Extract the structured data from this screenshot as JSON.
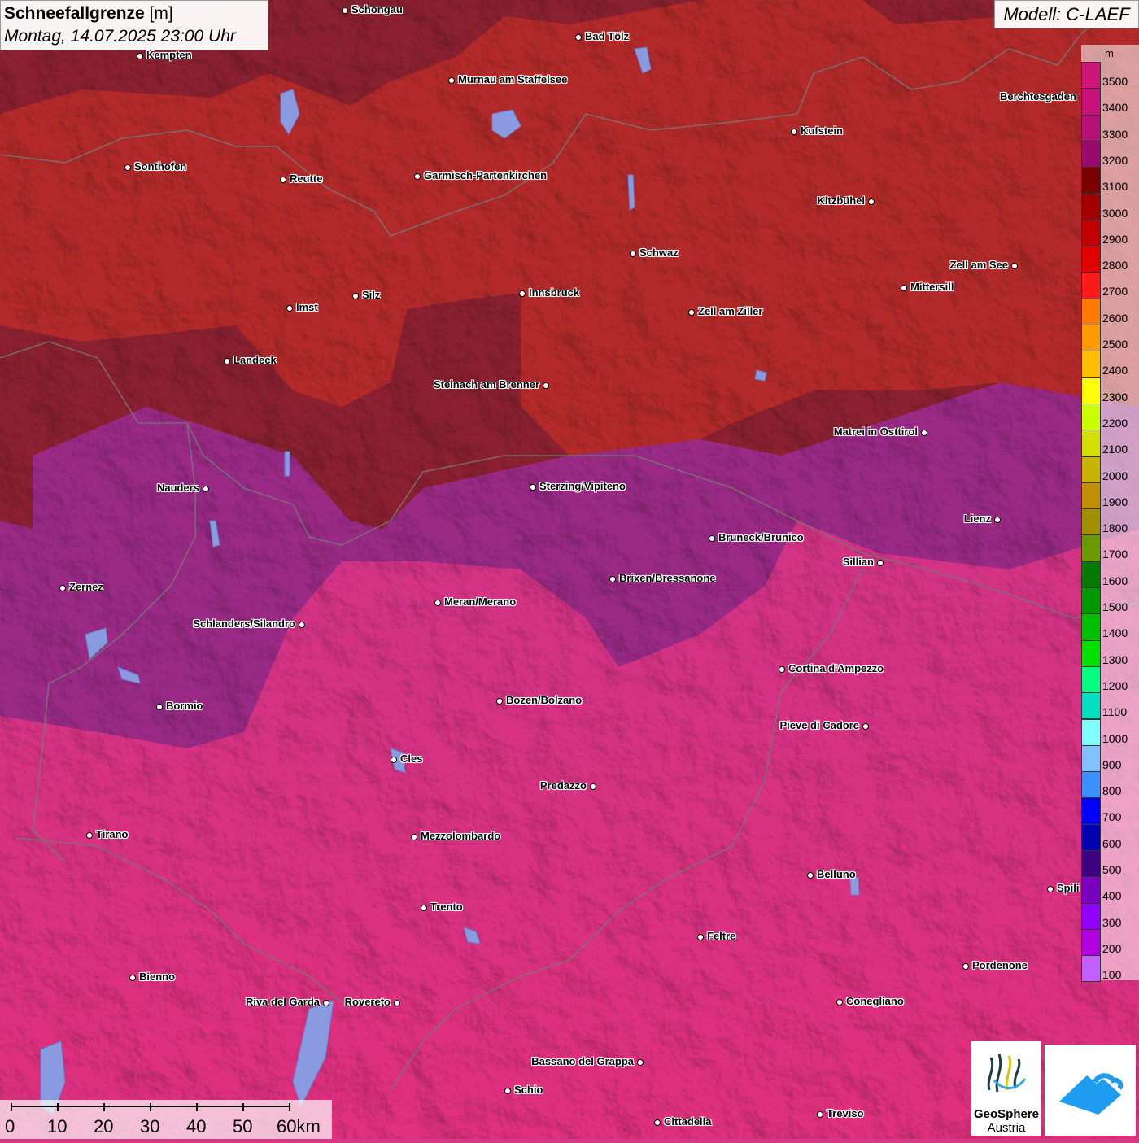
{
  "header": {
    "title": "Schneefallgrenze",
    "unit": "[m]",
    "datetime": "Montag, 14.07.2025 23:00 Uhr",
    "model": "Modell: C-LAEF"
  },
  "legend": {
    "unit": "m",
    "entries": [
      {
        "label": "3500",
        "color": "#d0157a"
      },
      {
        "label": "3400",
        "color": "#c6127a"
      },
      {
        "label": "3300",
        "color": "#b50f78"
      },
      {
        "label": "3200",
        "color": "#990a6c"
      },
      {
        "label": "3100",
        "color": "#7a0000"
      },
      {
        "label": "3000",
        "color": "#a00000"
      },
      {
        "label": "2900",
        "color": "#c00000"
      },
      {
        "label": "2800",
        "color": "#e00000"
      },
      {
        "label": "2700",
        "color": "#ff1a1a"
      },
      {
        "label": "2600",
        "color": "#ff7a00"
      },
      {
        "label": "2500",
        "color": "#ff9a00"
      },
      {
        "label": "2400",
        "color": "#ffbf00"
      },
      {
        "label": "2300",
        "color": "#ffff00"
      },
      {
        "label": "2200",
        "color": "#ccff00"
      },
      {
        "label": "2100",
        "color": "#d4e000"
      },
      {
        "label": "2000",
        "color": "#c8b400"
      },
      {
        "label": "1900",
        "color": "#c09000"
      },
      {
        "label": "1800",
        "color": "#a09000"
      },
      {
        "label": "1700",
        "color": "#6a9a00"
      },
      {
        "label": "1600",
        "color": "#007a00"
      },
      {
        "label": "1500",
        "color": "#009a00"
      },
      {
        "label": "1400",
        "color": "#00c000"
      },
      {
        "label": "1300",
        "color": "#00e000"
      },
      {
        "label": "1200",
        "color": "#00ff80"
      },
      {
        "label": "1100",
        "color": "#00e0c0"
      },
      {
        "label": "1000",
        "color": "#80ffff"
      },
      {
        "label": "900",
        "color": "#80c0ff"
      },
      {
        "label": "800",
        "color": "#3a90ff"
      },
      {
        "label": "700",
        "color": "#0000ff"
      },
      {
        "label": "600",
        "color": "#0000b0"
      },
      {
        "label": "500",
        "color": "#3a0080"
      },
      {
        "label": "400",
        "color": "#7a00c0"
      },
      {
        "label": "300",
        "color": "#9000ff"
      },
      {
        "label": "200",
        "color": "#b000e0"
      },
      {
        "label": "100",
        "color": "#c060ff"
      }
    ]
  },
  "cities": [
    {
      "name": "Schongau",
      "dot": "left"
    },
    {
      "name": "Bad Tölz",
      "dot": "left"
    },
    {
      "name": "Kempten",
      "dot": "left"
    },
    {
      "name": "Murnau am Staffelsee",
      "dot": "left"
    },
    {
      "name": "Berchtesgaden",
      "dot": "none"
    },
    {
      "name": "Kufstein",
      "dot": "left"
    },
    {
      "name": "Sonthofen",
      "dot": "left"
    },
    {
      "name": "Reutte",
      "dot": "left"
    },
    {
      "name": "Garmisch-Partenkirchen",
      "dot": "left"
    },
    {
      "name": "Kitzbühel",
      "dot": "right"
    },
    {
      "name": "Schwaz",
      "dot": "left"
    },
    {
      "name": "Zell am See",
      "dot": "right"
    },
    {
      "name": "Mittersill",
      "dot": "left"
    },
    {
      "name": "Innsbruck",
      "dot": "left"
    },
    {
      "name": "Silz",
      "dot": "left"
    },
    {
      "name": "Imst",
      "dot": "left"
    },
    {
      "name": "Zell am Ziller",
      "dot": "left"
    },
    {
      "name": "Landeck",
      "dot": "left"
    },
    {
      "name": "Steinach am Brenner",
      "dot": "right"
    },
    {
      "name": "Matrei in Osttirol",
      "dot": "right"
    },
    {
      "name": "Nauders",
      "dot": "right"
    },
    {
      "name": "Sterzing/Vipiteno",
      "dot": "left"
    },
    {
      "name": "Lienz",
      "dot": "right"
    },
    {
      "name": "Bruneck/Brunico",
      "dot": "left"
    },
    {
      "name": "Sillian",
      "dot": "right"
    },
    {
      "name": "Zernez",
      "dot": "left"
    },
    {
      "name": "Brixen/Bressanone",
      "dot": "left"
    },
    {
      "name": "Meran/Merano",
      "dot": "left"
    },
    {
      "name": "Schlanders/Silandro",
      "dot": "right"
    },
    {
      "name": "Cortina d'Ampezzo",
      "dot": "left"
    },
    {
      "name": "Bormio",
      "dot": "left"
    },
    {
      "name": "Bozen/Bolzano",
      "dot": "left"
    },
    {
      "name": "Pieve di Cadore",
      "dot": "right"
    },
    {
      "name": "Cles",
      "dot": "left"
    },
    {
      "name": "Predazzo",
      "dot": "right"
    },
    {
      "name": "Tirano",
      "dot": "left"
    },
    {
      "name": "Mezzolombardo",
      "dot": "left"
    },
    {
      "name": "Belluno",
      "dot": "left"
    },
    {
      "name": "Spili",
      "dot": "left"
    },
    {
      "name": "Trento",
      "dot": "left"
    },
    {
      "name": "Feltre",
      "dot": "left"
    },
    {
      "name": "Pordenone",
      "dot": "left"
    },
    {
      "name": "Bienno",
      "dot": "left"
    },
    {
      "name": "Riva del Garda",
      "dot": "right"
    },
    {
      "name": "Rovereto",
      "dot": "right"
    },
    {
      "name": "Conegliano",
      "dot": "left"
    },
    {
      "name": "Bassano del Grappa",
      "dot": "right"
    },
    {
      "name": "Schio",
      "dot": "left"
    },
    {
      "name": "Treviso",
      "dot": "left"
    },
    {
      "name": "Cittadella",
      "dot": "left"
    }
  ],
  "scale": {
    "labels": [
      "0",
      "10",
      "20",
      "30",
      "40",
      "50",
      "60km"
    ]
  },
  "logos": {
    "geosphere_line1": "GeoSphere",
    "geosphere_line2": "Austria"
  }
}
